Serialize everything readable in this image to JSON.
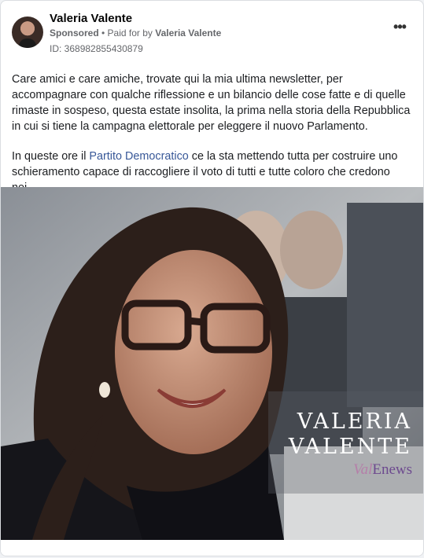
{
  "post": {
    "page_name": "Valeria Valente",
    "sponsored_label": "Sponsored",
    "separator": " • ",
    "paid_for_prefix": "Paid for by ",
    "paid_for_name": "Valeria Valente",
    "ad_id": "ID: 368982855430879",
    "more_icon": "more-horizontal-icon",
    "more_glyph": "•••"
  },
  "body": {
    "paragraph1": "Care amici e care amiche, trovate qui la mia ultima newsletter, per accompagnare con qualche riflessione e un bilancio delle cose fatte e di quelle rimaste in sospeso, questa estate insolita, la prima nella storia della Repubblica in cui si tiene la campagna elettorale per eleggere il nuovo Parlamento.",
    "paragraph2_before": "In queste ore il ",
    "paragraph2_link": "Partito Democratico",
    "paragraph2_after": " ce la sta mettendo tutta per costruire uno schieramento capace di raccogliere il voto di tutti e tutte coloro che credono nei…"
  },
  "image": {
    "overlay_first_name": "VALERIA",
    "overlay_last_name": "VALENTE",
    "overlay_news_prefix": "Val",
    "overlay_news_suffix": "Enews"
  },
  "colors": {
    "link": "#385898",
    "secondary_text": "#65676b",
    "primary_text": "#1c1e21"
  }
}
